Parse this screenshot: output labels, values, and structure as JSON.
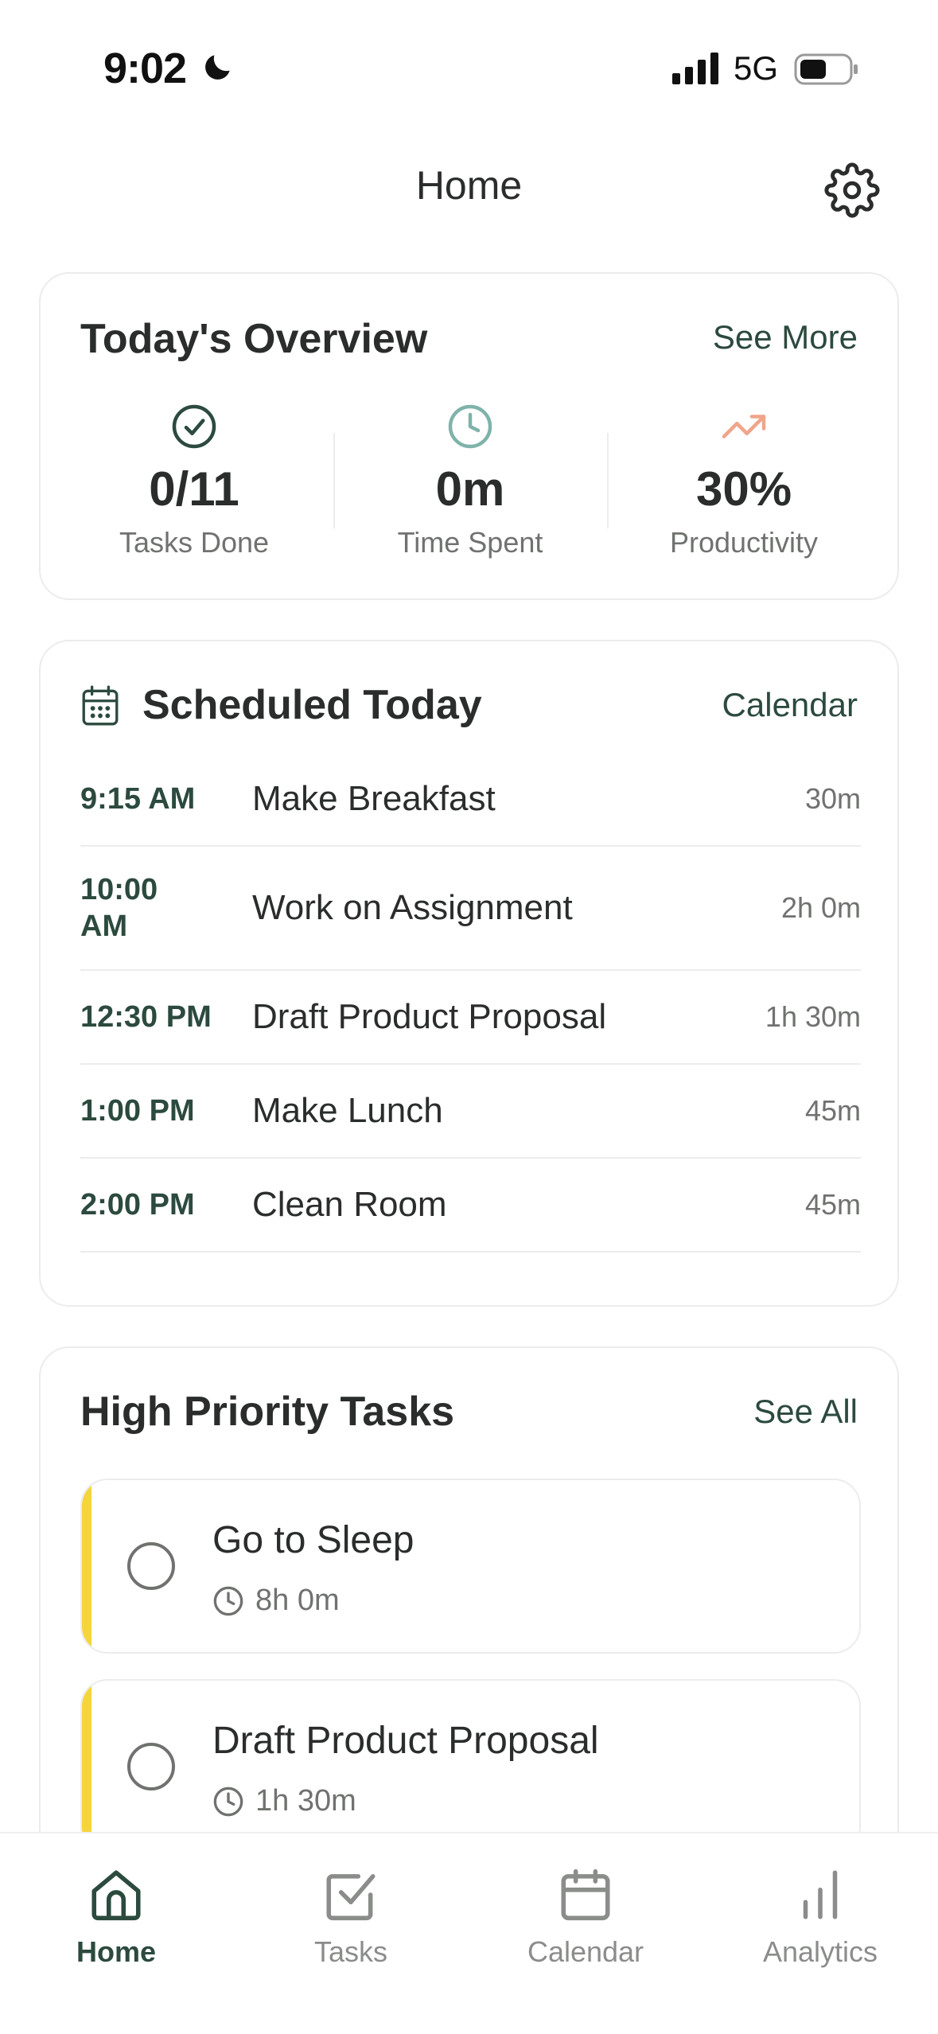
{
  "status_bar": {
    "time": "9:02",
    "network": "5G"
  },
  "header": {
    "title": "Home",
    "settings_icon": "gear-icon"
  },
  "overview": {
    "title": "Today's Overview",
    "link": "See More",
    "stats": [
      {
        "value": "0/11",
        "label": "Tasks Done",
        "icon": "check-circle-icon",
        "color": "#2c4a3e"
      },
      {
        "value": "0m",
        "label": "Time Spent",
        "icon": "clock-icon",
        "color": "#7fb3aa"
      },
      {
        "value": "30%",
        "label": "Productivity",
        "icon": "trending-up-icon",
        "color": "#f0a58a"
      }
    ]
  },
  "schedule": {
    "title": "Scheduled Today",
    "link": "Calendar",
    "items": [
      {
        "time": "9:15 AM",
        "name": "Make Breakfast",
        "duration": "30m"
      },
      {
        "time": "10:00 AM",
        "name": "Work on Assignment",
        "duration": "2h 0m"
      },
      {
        "time": "12:30 PM",
        "name": "Draft Product Proposal",
        "duration": "1h 30m"
      },
      {
        "time": "1:00 PM",
        "name": "Make Lunch",
        "duration": "45m"
      },
      {
        "time": "2:00 PM",
        "name": "Clean Room",
        "duration": "45m"
      }
    ]
  },
  "priority": {
    "title": "High Priority Tasks",
    "link": "See All",
    "accent_color": "#f6d53a",
    "tasks": [
      {
        "name": "Go to Sleep",
        "duration": "8h 0m"
      },
      {
        "name": "Draft Product Proposal",
        "duration": "1h 30m"
      }
    ]
  },
  "nav": {
    "items": [
      {
        "label": "Home",
        "icon": "home-icon",
        "active": true
      },
      {
        "label": "Tasks",
        "icon": "checkbox-icon",
        "active": false
      },
      {
        "label": "Calendar",
        "icon": "calendar-icon",
        "active": false
      },
      {
        "label": "Analytics",
        "icon": "bar-chart-icon",
        "active": false
      }
    ]
  },
  "colors": {
    "primary": "#2c4a3e",
    "muted": "#6f726f",
    "accent": "#f6d53a"
  }
}
